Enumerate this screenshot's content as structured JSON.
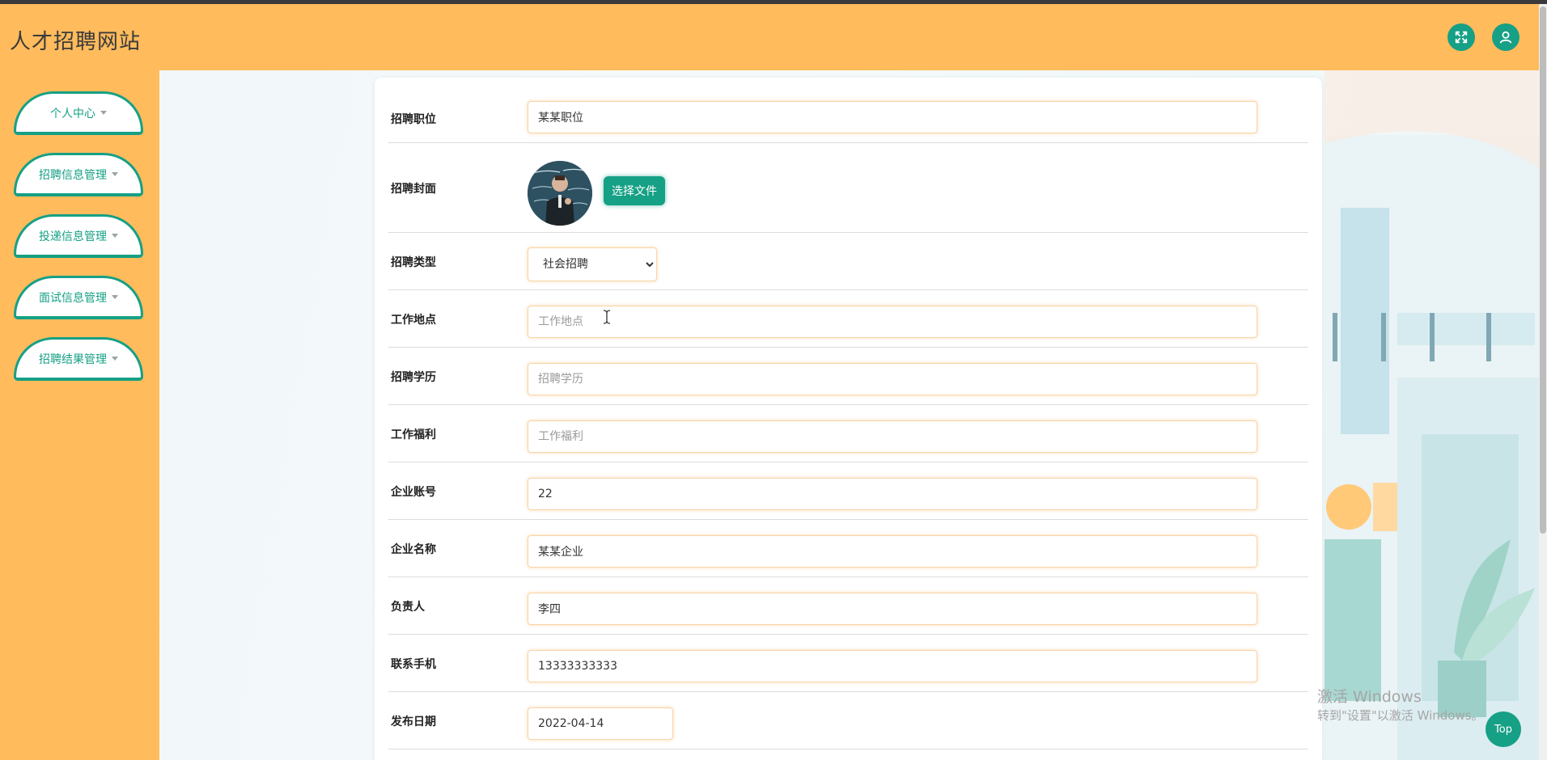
{
  "site": {
    "title": "人才招聘网站"
  },
  "header": {
    "fullscreen_icon": "expand-icon",
    "user_icon": "user-icon"
  },
  "sidebar": {
    "items": [
      {
        "label": "个人中心"
      },
      {
        "label": "招聘信息管理"
      },
      {
        "label": "投递信息管理"
      },
      {
        "label": "面试信息管理"
      },
      {
        "label": "招聘结果管理"
      }
    ]
  },
  "form": {
    "position": {
      "label": "招聘职位",
      "value": "某某职位",
      "placeholder": ""
    },
    "cover": {
      "label": "招聘封面",
      "button_label": "选择文件"
    },
    "type": {
      "label": "招聘类型",
      "selected": "社会招聘"
    },
    "location": {
      "label": "工作地点",
      "value": "",
      "placeholder": "工作地点"
    },
    "education": {
      "label": "招聘学历",
      "value": "",
      "placeholder": "招聘学历"
    },
    "benefits": {
      "label": "工作福利",
      "value": "",
      "placeholder": "工作福利"
    },
    "account": {
      "label": "企业账号",
      "value": "22"
    },
    "company": {
      "label": "企业名称",
      "value": "某某企业"
    },
    "manager": {
      "label": "负责人",
      "value": "李四"
    },
    "phone": {
      "label": "联系手机",
      "value": "13333333333"
    },
    "date": {
      "label": "发布日期",
      "value": "2022-04-14"
    }
  },
  "watermark": {
    "line1": "激活 Windows",
    "line2": "转到\"设置\"以激活 Windows。"
  },
  "top_button": {
    "label": "Top"
  },
  "colors": {
    "accent": "#16a085",
    "header_bg": "#ffbb5c"
  }
}
